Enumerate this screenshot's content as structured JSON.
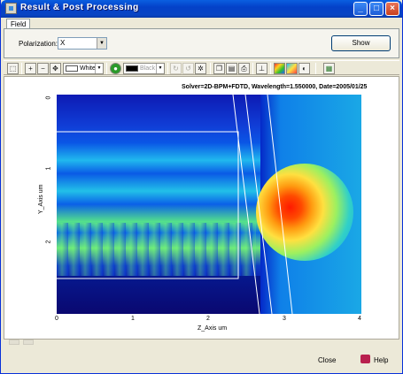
{
  "window": {
    "title": "Result & Post Processing",
    "controls": {
      "minimize": "_",
      "maximize": "□",
      "close": "×"
    }
  },
  "tabs": [
    {
      "label": "Field"
    }
  ],
  "controls": {
    "polarization_label": "Polarization:",
    "polarization_value": "X",
    "show_button": "Show"
  },
  "toolbar": {
    "background_color_label": "White",
    "line_color_label": "Black",
    "icons": [
      "select-icon",
      "zoom-in-icon",
      "zoom-out-icon",
      "pan-icon",
      "color-wheel-icon",
      "copy-icon",
      "preview-icon",
      "print-icon",
      "axis-icon",
      "palette-icon",
      "layers-icon",
      "grid-icon"
    ]
  },
  "plot": {
    "caption": "Solver=2D-BPM+FDTD, Wavelength=1.550000, Date=2005/01/25",
    "xlabel": "Z_Axis um",
    "ylabel": "Y_Axis um",
    "xticks": [
      "0",
      "1",
      "2",
      "3",
      "4"
    ],
    "yticks": [
      "0",
      "1",
      "2"
    ]
  },
  "footer": {
    "close": "Close",
    "help": "Help"
  }
}
